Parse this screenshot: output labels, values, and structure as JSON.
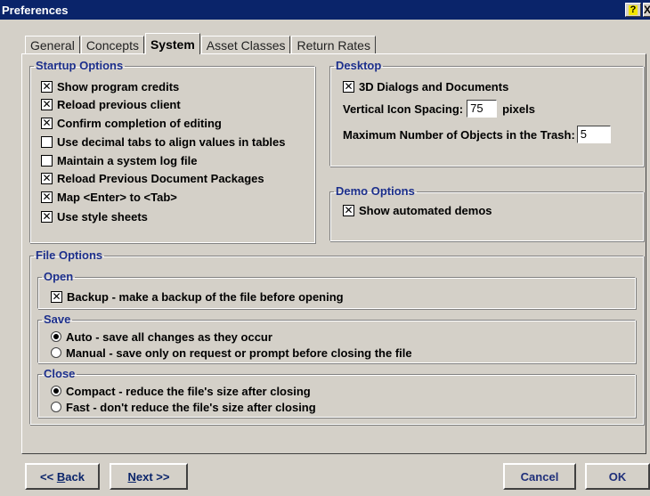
{
  "window": {
    "title": "Preferences",
    "help_label": "?",
    "close_label": "X"
  },
  "tabs": [
    {
      "label": "General"
    },
    {
      "label": "Concepts"
    },
    {
      "label": "System"
    },
    {
      "label": "Asset Classes"
    },
    {
      "label": "Return Rates"
    }
  ],
  "startup": {
    "legend": "Startup Options",
    "items": [
      {
        "label": "Show program credits",
        "checked": true
      },
      {
        "label": "Reload previous client",
        "checked": true
      },
      {
        "label": "Confirm completion of editing",
        "checked": true
      },
      {
        "label": "Use decimal tabs to align values in tables",
        "checked": false
      },
      {
        "label": "Maintain a system log file",
        "checked": false
      },
      {
        "label": "Reload Previous Document Packages",
        "checked": true
      },
      {
        "label": "Map <Enter> to <Tab>",
        "checked": true
      },
      {
        "label": "Use style sheets",
        "checked": true
      }
    ]
  },
  "desktop": {
    "legend": "Desktop",
    "dialogs_label": "3D Dialogs and Documents",
    "dialogs_checked": true,
    "spacing_label": "Vertical Icon Spacing:",
    "spacing_value": "75",
    "spacing_unit": "pixels",
    "trash_label": "Maximum Number of Objects in the Trash:",
    "trash_value": "5"
  },
  "demo": {
    "legend": "Demo Options",
    "label": "Show automated demos",
    "checked": true
  },
  "file_options": {
    "legend": "File Options",
    "open": {
      "legend": "Open",
      "label": "Backup - make a backup of the file before opening",
      "checked": true
    },
    "save": {
      "legend": "Save",
      "options": [
        {
          "label": "Auto - save all changes as they occur",
          "selected": true
        },
        {
          "label": "Manual - save only on request or prompt before closing the file",
          "selected": false
        }
      ]
    },
    "close": {
      "legend": "Close",
      "options": [
        {
          "label": "Compact - reduce the file's size after closing",
          "selected": true
        },
        {
          "label": "Fast - don't reduce the file's size after closing",
          "selected": false
        }
      ]
    }
  },
  "buttons": {
    "back_prefix": "<< ",
    "back_key": "B",
    "back_rest": "ack",
    "next_key": "N",
    "next_rest": "ext >>",
    "cancel": "Cancel",
    "ok": "OK"
  }
}
